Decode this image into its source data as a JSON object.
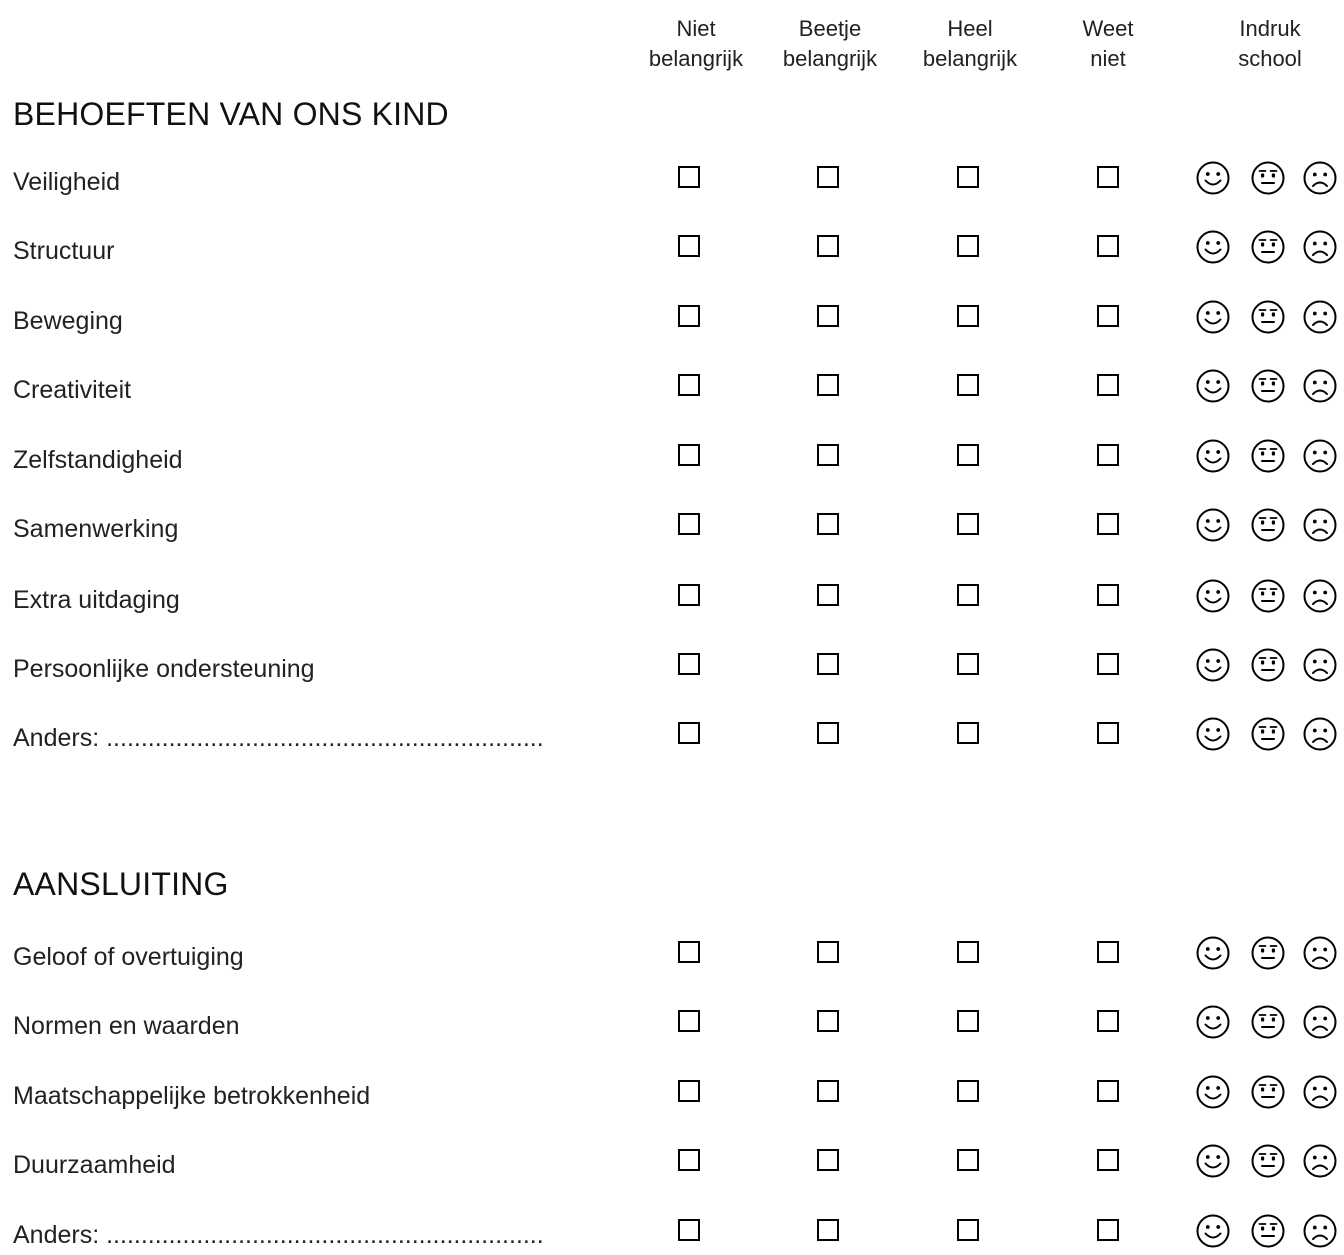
{
  "columns": [
    {
      "line1": "Niet",
      "line2": "belangrijk"
    },
    {
      "line1": "Beetje",
      "line2": "belangrijk"
    },
    {
      "line1": "Heel",
      "line2": "belangrijk"
    },
    {
      "line1": "Weet",
      "line2": "niet"
    },
    {
      "line1": "Indruk",
      "line2": "school"
    }
  ],
  "sections": [
    {
      "title": "BEHOEFTEN VAN ONS KIND",
      "items": [
        "Veiligheid",
        "Structuur",
        "Beweging",
        "Creativiteit",
        "Zelfstandigheid",
        "Samenwerking",
        "Extra uitdaging",
        "Persoonlijke ondersteuning",
        "Anders: ..............................................................."
      ]
    },
    {
      "title": "AANSLUITING",
      "items": [
        "Geloof of overtuiging",
        "Normen en waarden",
        "Maatschappelijke betrokkenheid",
        "Duurzaamheid",
        "Anders: ..............................................................."
      ]
    }
  ],
  "icons": {
    "checkbox": "checkbox-empty",
    "faces": [
      "happy-face-icon",
      "neutral-face-icon",
      "sad-face-icon"
    ]
  }
}
